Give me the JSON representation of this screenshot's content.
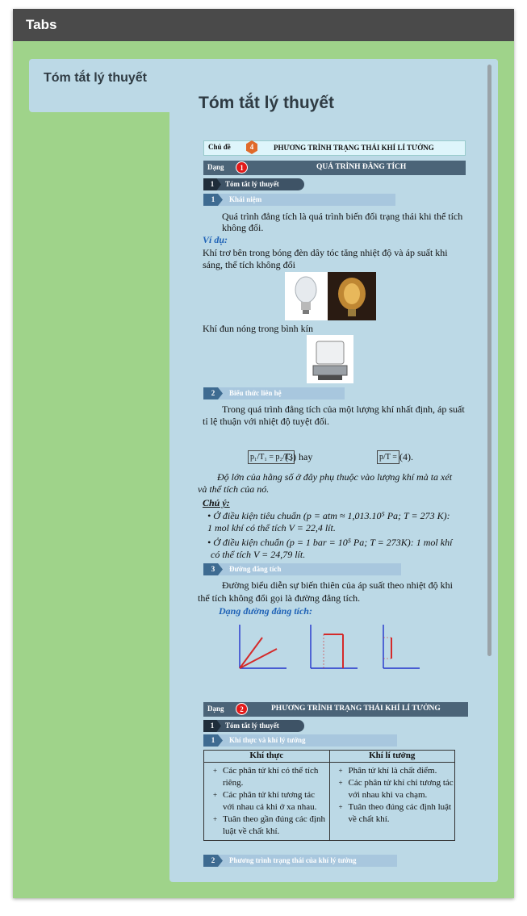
{
  "window": {
    "title": "Tabs"
  },
  "tabs": [
    {
      "label": "Tóm tắt lý thuyết",
      "selected": true
    }
  ],
  "content": {
    "title": "Tóm tắt lý thuyết",
    "doc": {
      "chu_de_label": "Chủ đề",
      "chu_de_num": "4",
      "chu_de_title": "PHƯƠNG TRÌNH TRẠNG THÁI KHÍ LÍ TƯỞNG",
      "dang1": {
        "label": "Dạng",
        "num": "1",
        "title": "QUÁ TRÌNH ĐẲNG TÍCH"
      },
      "sec1": {
        "num": "1",
        "title": "Tóm tắt lý thuyết"
      },
      "sub_khai_niem": {
        "num": "1",
        "title": "Khái niệm"
      },
      "khai_niem_text_1": "Quá trình đẳng tích là quá trình biến đổi trạng thái khi thể tích",
      "khai_niem_text_2": "không đổi.",
      "vi_du": "Ví dụ:",
      "vi_du_1a": "Khí trơ bên trong bóng đèn dây tóc tăng nhiệt độ và áp suất khi",
      "vi_du_1b": "sáng, thể tích không đổi",
      "vi_du_2": "Khí đun nóng trong bình kín",
      "sub_bieu_thuc": {
        "num": "2",
        "title": "Biểu thức liên hệ"
      },
      "bieu_thuc_1": "Trong quá trình đẳng tích của một lượng khí nhất định, áp suất",
      "bieu_thuc_2": "tỉ lệ thuận với nhiệt độ tuyệt đối.",
      "formula_1": "p₁/T₁ = p₂/T₂",
      "formula_1_tail": "(3) hay",
      "formula_2": "p/T =",
      "formula_2_tail": "(4).",
      "hang_so_1": "Độ lớn của hằng số ở đây phụ thuộc vào lượng khí mà ta xét",
      "hang_so_2": "và thể tích của nó.",
      "chu_y": "Chú ý:",
      "chu_y_1a": "Ở điều kiện tiêu chuẩn (p = atm ≈ 1,013.10⁵ Pa; T = 273 K):",
      "chu_y_1b": "1 mol khí có thể tích V = 22,4 lít.",
      "chu_y_2a": "Ở điều kiện chuẩn (p = 1 bar = 10⁵ Pa; T = 273K): 1 mol khí",
      "chu_y_2b": "có thể tích V = 24,79 lít.",
      "sub_duong": {
        "num": "3",
        "title": "Đường đẳng tích"
      },
      "duong_1": "Đường biểu diễn sự biến thiên của áp suất theo nhiệt độ khi",
      "duong_2": "thể tích không đổi gọi là đường đẳng tích.",
      "dang_duong": "Dạng đường đẳng tích:",
      "dang2": {
        "label": "Dạng",
        "num": "2",
        "title": "PHƯƠNG TRÌNH TRẠNG THÁI KHÍ LÍ TƯỞNG"
      },
      "sec2": {
        "num": "1",
        "title": "Tóm tắt lý thuyết"
      },
      "sub_khi_thuc": {
        "num": "1",
        "title": "Khí thực và khí lý tưởng"
      },
      "table": {
        "headers": [
          "Khí thực",
          "Khí lí tưởng"
        ],
        "col1": [
          "Các phân tử khí có thể tích riêng.",
          "Các phân tử khí tương tác với nhau cả khi ở xa nhau.",
          "Tuân theo gần đúng các định luật về chất khí."
        ],
        "col2": [
          "Phân tử khí là chất điểm.",
          "Các phân tử khí chỉ tương tác với nhau khi va chạm.",
          "Tuân theo đúng các định luật về chất khí."
        ]
      },
      "sub_pt": {
        "num": "2",
        "title": "Phương trình trạng thái của khí lý tưởng"
      }
    }
  }
}
